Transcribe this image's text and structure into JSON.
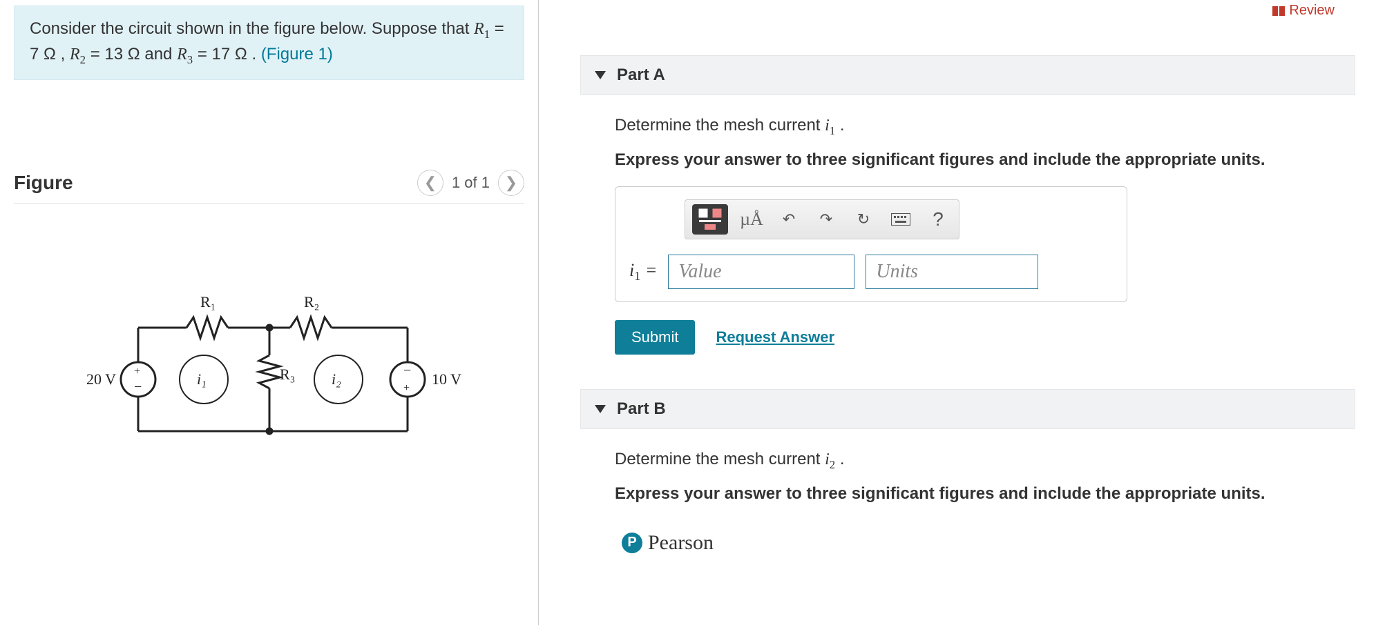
{
  "review_label": "Review",
  "problem": {
    "line1_pre": "Consider the circuit shown in the figure below. Suppose that ",
    "r1_label": "R",
    "r1_sub": "1",
    "r1_val": " = 7 Ω , ",
    "r2_label": "R",
    "r2_sub": "2",
    "r2_val": " = 13 Ω and ",
    "r3_label": "R",
    "r3_sub": "3",
    "r3_val": " = 17 Ω . ",
    "fig_ref": "(Figure 1)"
  },
  "figure": {
    "title": "Figure",
    "pager": "1 of 1",
    "labels": {
      "R1": "R₁",
      "R2": "R₂",
      "R3": "R₃",
      "i1": "i₁",
      "i2": "i₂",
      "VL": "20 V",
      "VR": "10 V"
    }
  },
  "partA": {
    "title": "Part A",
    "prompt_pre": "Determine the mesh current ",
    "prompt_var": "i",
    "prompt_sub": "1",
    "prompt_post": " .",
    "instruction": "Express your answer to three significant figures and include the appropriate units.",
    "lhs_var": "i",
    "lhs_sub": "1",
    "lhs_eq": " = ",
    "value_placeholder": "Value",
    "units_placeholder": "Units",
    "submit": "Submit",
    "request": "Request Answer",
    "toolbar_special": "µÅ",
    "toolbar_help": "?"
  },
  "partB": {
    "title": "Part B",
    "prompt_pre": "Determine the mesh current ",
    "prompt_var": "i",
    "prompt_sub": "2",
    "prompt_post": " .",
    "instruction": "Express your answer to three significant figures and include the appropriate units."
  },
  "brand": "Pearson"
}
